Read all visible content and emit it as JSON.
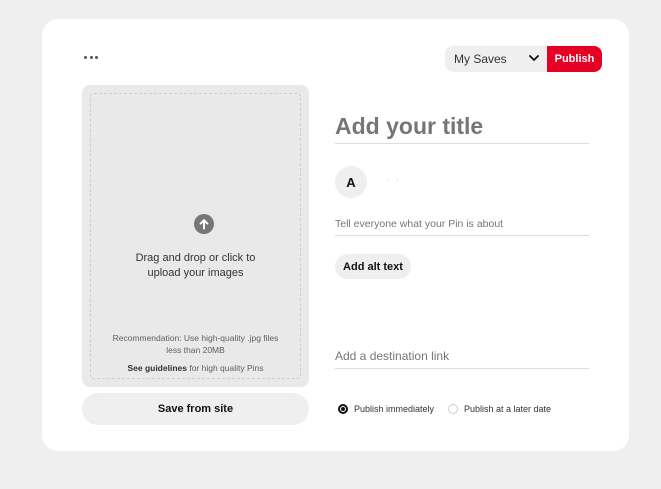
{
  "header": {
    "more_icon": "more-horizontal-icon",
    "board_select": {
      "selected": "My Saves"
    },
    "publish_label": "Publish",
    "accent_color": "#e60023"
  },
  "upload": {
    "icon": "arrow-up-circle-icon",
    "drag_line1": "Drag and drop or click to",
    "drag_line2": "upload your images",
    "recommendation_line1": "Recommendation: Use high-quality .jpg files",
    "recommendation_line2": "less than 20MB",
    "guidelines_link": "See guidelines",
    "guidelines_rest": " for high quality Pins",
    "save_from_site": "Save from site"
  },
  "form": {
    "title_placeholder": "Add your title",
    "avatar_initial": "A",
    "avatar_name": "· ·",
    "about_placeholder": "Tell everyone what your Pin is about",
    "alt_text_button": "Add alt text",
    "destination_placeholder": "Add a destination link"
  },
  "publish_options": {
    "immediately": "Publish immediately",
    "later": "Publish at a later date",
    "selected": "immediately"
  }
}
